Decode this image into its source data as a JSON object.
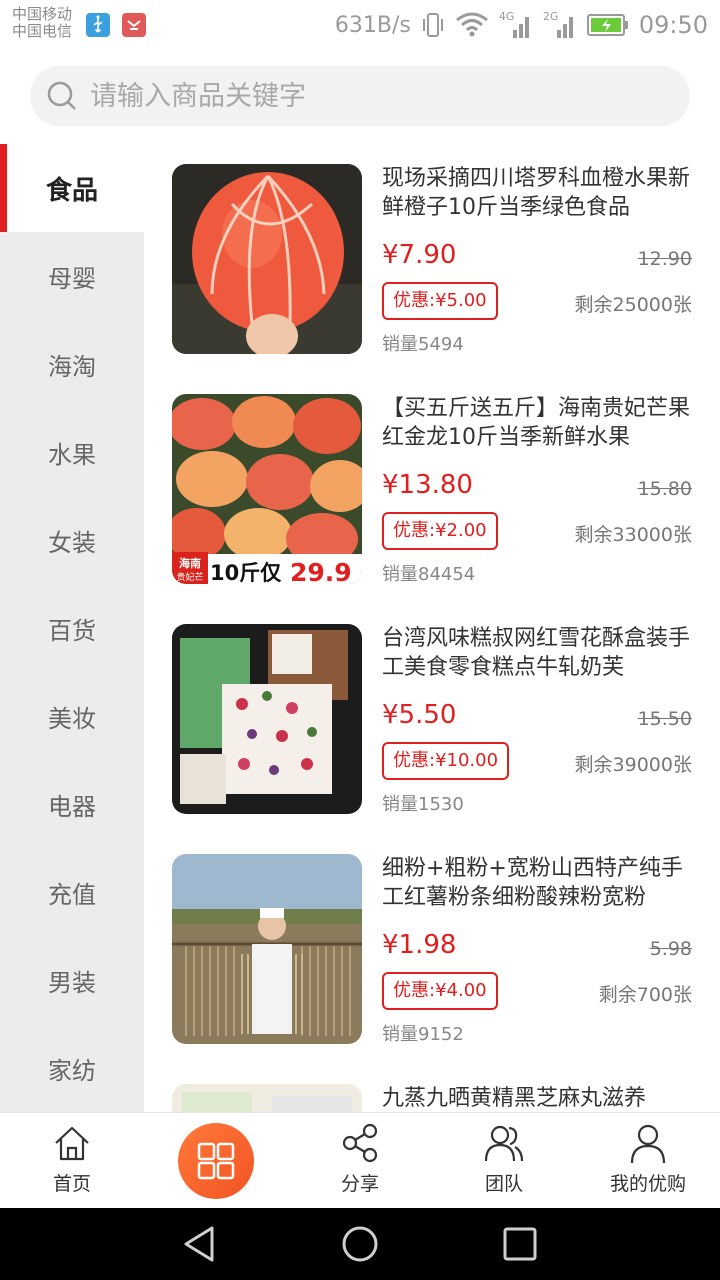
{
  "status_bar": {
    "carrier_1": "中国移动",
    "carrier_2": "中国电信",
    "net_speed": "631B/s",
    "net_4g": "4G",
    "net_2g": "2G",
    "time": "09:50",
    "icons": [
      "usb-icon",
      "debug-icon",
      "vibrate-icon",
      "wifi-icon",
      "signal-icon",
      "battery-charging-icon"
    ]
  },
  "search": {
    "placeholder": "请输入商品关键字"
  },
  "sidebar": {
    "items": [
      {
        "label": "食品",
        "active": true
      },
      {
        "label": "母婴"
      },
      {
        "label": "海淘"
      },
      {
        "label": "水果"
      },
      {
        "label": "女装"
      },
      {
        "label": "百货"
      },
      {
        "label": "美妆"
      },
      {
        "label": "电器"
      },
      {
        "label": "充值"
      },
      {
        "label": "男装"
      },
      {
        "label": "家纺"
      }
    ]
  },
  "products": [
    {
      "title": "现场采摘四川塔罗科血橙水果新鲜橙子10斤当季绿色食品",
      "price": "¥7.90",
      "original_price": "12.90",
      "coupon": "优惠:¥5.00",
      "remaining": "剩余25000张",
      "sales": "销量5494"
    },
    {
      "title": "【买五斤送五斤】海南贵妃芒果红金龙10斤当季新鲜水果",
      "price": "¥13.80",
      "original_price": "15.80",
      "coupon": "优惠:¥2.00",
      "remaining": "剩余33000张",
      "sales": "销量84454",
      "image_text": {
        "tag": "海南",
        "tag2": "贵妃芒",
        "promo": "10斤仅",
        "promo_price": "29.9"
      }
    },
    {
      "title": "台湾风味糕叔网红雪花酥盒装手工美食零食糕点牛轧奶芙",
      "price": "¥5.50",
      "original_price": "15.50",
      "coupon": "优惠:¥10.00",
      "remaining": "剩余39000张",
      "sales": "销量1530"
    },
    {
      "title": "细粉+粗粉+宽粉山西特产纯手工红薯粉条细粉酸辣粉宽粉",
      "price": "¥1.98",
      "original_price": "5.98",
      "coupon": "优惠:¥4.00",
      "remaining": "剩余700张",
      "sales": "销量9152"
    },
    {
      "title": "九蒸九晒黄精黑芝麻丸滋养"
    }
  ],
  "tab_bar": {
    "home": "首页",
    "share": "分享",
    "team": "团队",
    "mine": "我的优购"
  },
  "colors": {
    "accent": "#e02020",
    "center_button": "#f25323"
  }
}
